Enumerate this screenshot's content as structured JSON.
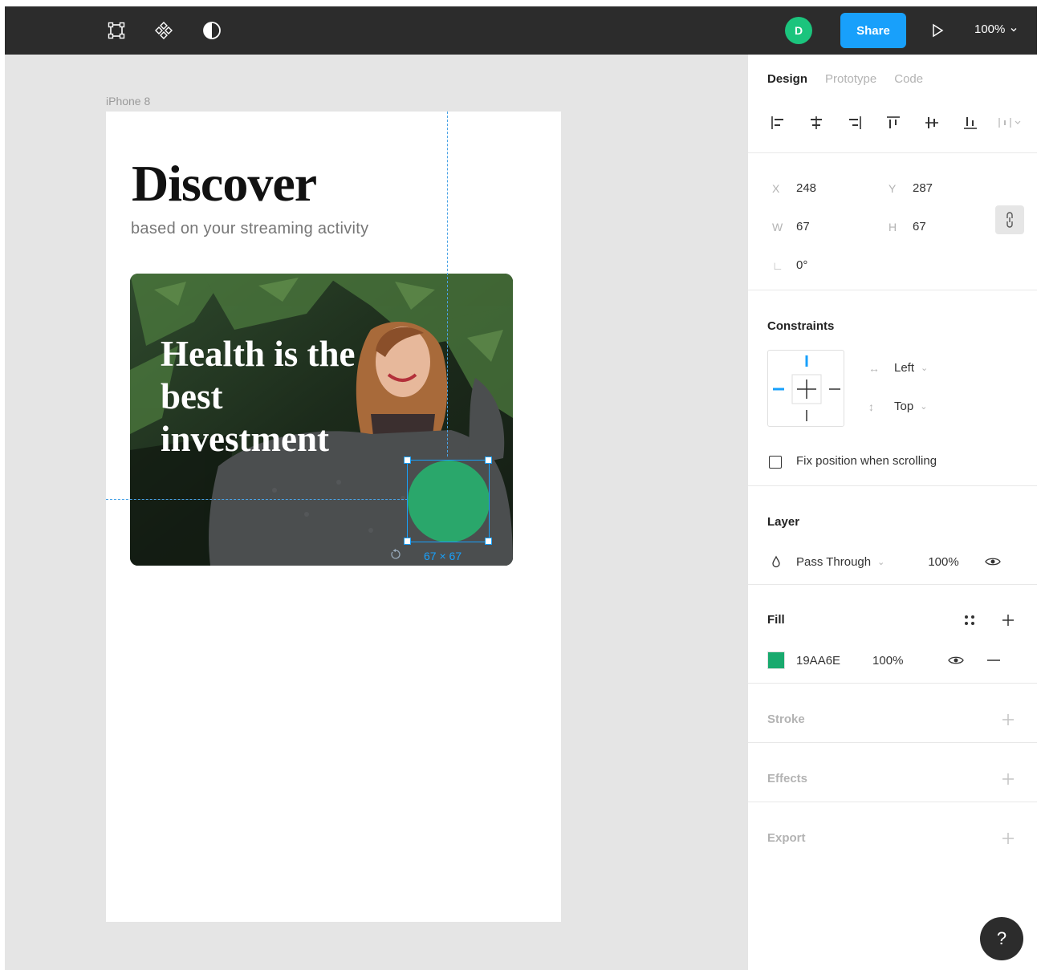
{
  "toolbar": {
    "avatar_initial": "D",
    "share_label": "Share",
    "zoom": "100%",
    "icons": [
      "frame-icon",
      "component-icon",
      "contrast-icon",
      "play-icon"
    ]
  },
  "canvas": {
    "frame_label": "iPhone 8",
    "heading": "Discover",
    "subtitle": "based on your streaming activity",
    "card_title": "Health is the best investment",
    "selection_size": "67 × 67",
    "selected_fill": "#2aa76b"
  },
  "panel": {
    "tabs": [
      "Design",
      "Prototype",
      "Code"
    ],
    "position": {
      "x_label": "X",
      "x": "248",
      "y_label": "Y",
      "y": "287",
      "w_label": "W",
      "w": "67",
      "h_label": "H",
      "h": "67",
      "rotation_label": "∟",
      "rotation": "0°"
    },
    "constraints": {
      "title": "Constraints",
      "horizontal": "Left",
      "vertical": "Top",
      "fix_label": "Fix position when scrolling"
    },
    "layer": {
      "title": "Layer",
      "blend": "Pass Through",
      "opacity": "100%"
    },
    "fill": {
      "title": "Fill",
      "hex": "19AA6E",
      "opacity": "100%",
      "color": "#19aa6e"
    },
    "stroke_title": "Stroke",
    "effects_title": "Effects",
    "export_title": "Export"
  },
  "help_label": "?"
}
